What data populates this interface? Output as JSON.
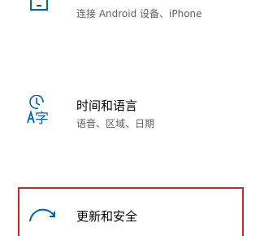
{
  "tiles": [
    {
      "id": "phone",
      "icon": "phone-icon",
      "title": "",
      "description": "连接 Android 设备、iPhone"
    },
    {
      "id": "time-language",
      "icon": "time-language-icon",
      "title": "时间和语言",
      "description": "语音、区域、日期"
    },
    {
      "id": "update-security",
      "icon": "update-sync-icon",
      "title": "更新和安全",
      "description": "",
      "selected": true
    }
  ],
  "colors": {
    "accent": "#0063b1",
    "selection_border": "#c62828",
    "description_text": "#5f5f5f"
  }
}
